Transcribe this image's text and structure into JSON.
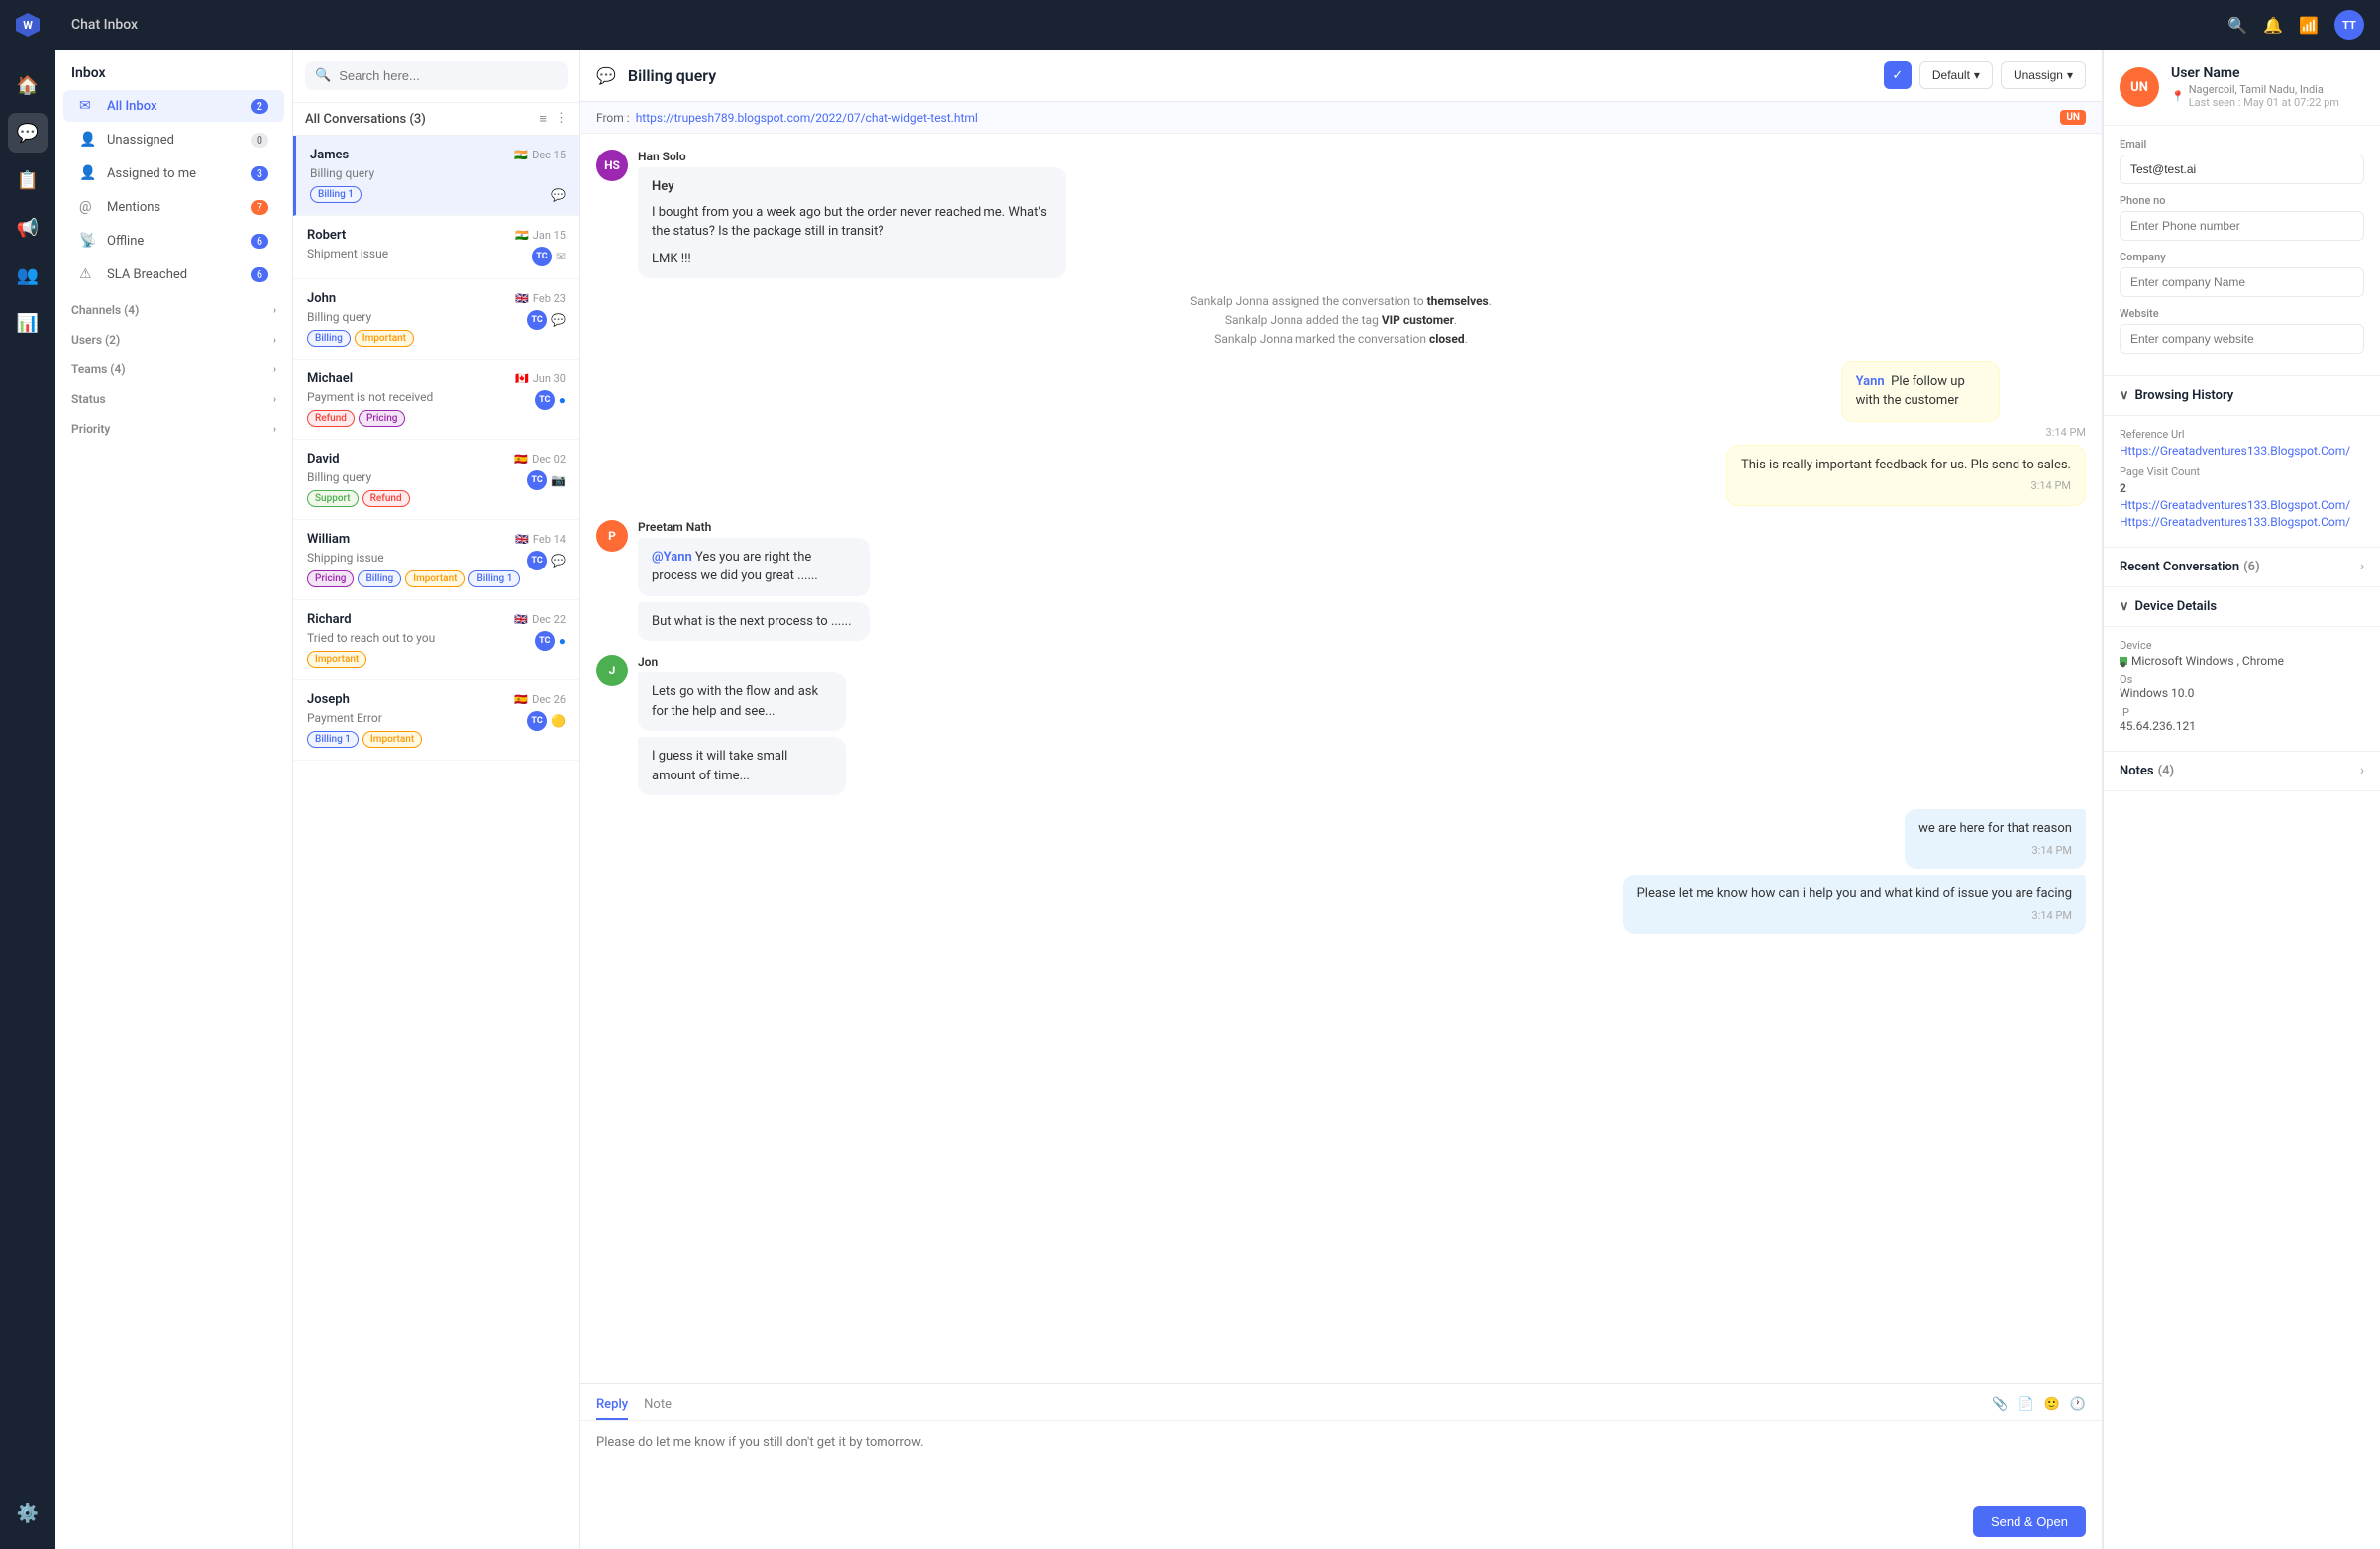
{
  "app": {
    "title": "Chat Inbox",
    "user_initials": "TT"
  },
  "nav": {
    "icons": [
      "🏠",
      "💬",
      "📋",
      "📢",
      "👥",
      "📊"
    ],
    "active_index": 1
  },
  "inbox_sidebar": {
    "header": "Inbox",
    "items": [
      {
        "id": "all-inbox",
        "label": "All Inbox",
        "icon": "✉",
        "badge": "2",
        "badge_type": "blue",
        "active": true
      },
      {
        "id": "unassigned",
        "label": "Unassigned",
        "icon": "👤",
        "badge": "0",
        "badge_type": "gray",
        "active": false
      },
      {
        "id": "assigned-to-me",
        "label": "Assigned to me",
        "icon": "👤",
        "badge": "3",
        "badge_type": "blue",
        "active": false
      },
      {
        "id": "mentions",
        "label": "Mentions",
        "icon": "@",
        "badge": "7",
        "badge_type": "orange",
        "active": false
      },
      {
        "id": "offline",
        "label": "Offline",
        "icon": "📡",
        "badge": "6",
        "badge_type": "blue",
        "active": false
      },
      {
        "id": "sla-breached",
        "label": "SLA Breached",
        "icon": "⚠",
        "badge": "6",
        "badge_type": "blue",
        "active": false
      }
    ],
    "sections": [
      {
        "label": "Channels (4)",
        "expandable": true
      },
      {
        "label": "Users (2)",
        "expandable": true
      },
      {
        "label": "Teams (4)",
        "expandable": true
      },
      {
        "label": "Status",
        "expandable": true
      },
      {
        "label": "Priority",
        "expandable": true
      }
    ]
  },
  "conv_panel": {
    "search_placeholder": "Search here...",
    "list_header": "All Conversations (3)",
    "conversations": [
      {
        "name": "James",
        "flag": "🇮🇳",
        "date": "Dec 15",
        "preview": "Billing query",
        "tags": [
          {
            "label": "Billing 1",
            "type": "billing"
          }
        ],
        "icon": "💬",
        "active": true,
        "avatar_color": "#4a6cf7",
        "avatar_initials": "TC"
      },
      {
        "name": "Robert",
        "flag": "🇮🇳",
        "date": "Jan 15",
        "preview": "Shipment issue",
        "tags": [],
        "icon": "✉",
        "active": false,
        "avatar_color": "#4a6cf7",
        "avatar_initials": "TC"
      },
      {
        "name": "John",
        "flag": "🇬🇧",
        "date": "Feb 23",
        "preview": "Billing query",
        "tags": [
          {
            "label": "Billing",
            "type": "billing"
          },
          {
            "label": "Important",
            "type": "important"
          }
        ],
        "icon": "💚",
        "active": false,
        "avatar_color": "#4a6cf7",
        "avatar_initials": "TC"
      },
      {
        "name": "Michael",
        "flag": "🇨🇦",
        "date": "Jun 30",
        "preview": "Payment is not received",
        "tags": [
          {
            "label": "Refund",
            "type": "refund"
          },
          {
            "label": "Pricing",
            "type": "pricing"
          }
        ],
        "icon": "🔵",
        "active": false,
        "avatar_color": "#4a6cf7",
        "avatar_initials": "TC"
      },
      {
        "name": "David",
        "flag": "🇪🇸",
        "date": "Dec 02",
        "preview": "Billing query",
        "tags": [
          {
            "label": "Support",
            "type": "support"
          },
          {
            "label": "Refund",
            "type": "refund"
          }
        ],
        "icon": "📷",
        "active": false,
        "avatar_color": "#4a6cf7",
        "avatar_initials": "TC"
      },
      {
        "name": "William",
        "flag": "🇬🇧",
        "date": "Feb 14",
        "preview": "Shipping issue",
        "tags": [
          {
            "label": "Pricing",
            "type": "pricing"
          },
          {
            "label": "Billing",
            "type": "billing"
          },
          {
            "label": "Important",
            "type": "important"
          },
          {
            "label": "Billing 1",
            "type": "billing"
          }
        ],
        "icon": "💬",
        "active": false,
        "avatar_color": "#4a6cf7",
        "avatar_initials": "TC"
      },
      {
        "name": "Richard",
        "flag": "🇬🇧",
        "date": "Dec 22",
        "preview": "Tried to reach out to you",
        "tags": [
          {
            "label": "Important",
            "type": "important"
          }
        ],
        "icon": "🔵",
        "active": false,
        "avatar_color": "#4a6cf7",
        "avatar_initials": "TC"
      },
      {
        "name": "Joseph",
        "flag": "🇪🇸",
        "date": "Dec 26",
        "preview": "Payment Error",
        "tags": [
          {
            "label": "Billing 1",
            "type": "billing"
          },
          {
            "label": "Important",
            "type": "important"
          }
        ],
        "icon": "🟡",
        "active": false,
        "avatar_color": "#4a6cf7",
        "avatar_initials": "TC"
      }
    ]
  },
  "chat": {
    "title": "Billing query",
    "title_icon": "💬",
    "from_label": "From :",
    "from_url": "https://trupesh789.blogspot.com/2022/07/chat-widget-test.html",
    "from_badge": "UN",
    "default_btn": "Default",
    "unassign_btn": "Unassign",
    "messages": [
      {
        "type": "incoming",
        "sender": "Han Solo",
        "initials": "HS",
        "avatar_color": "#9c27b0",
        "greeting": "Hey",
        "body": "I bought from you a week ago but the order never reached me. What's the status? Is the package still in transit?\n\nLMK !!!"
      },
      {
        "type": "system",
        "lines": [
          "Sankalp Jonna assigned the conversation to <strong>themselves</strong>.",
          "Sankalp Jonna added the tag <strong>VIP customer</strong>.",
          "Sankalp Jonna marked the conversation <strong>closed</strong>."
        ]
      },
      {
        "type": "outgoing-note",
        "sender": "Yann",
        "time": "3:14 PM",
        "body1": "Ple follow up with the customer",
        "body2": "This is really important feedback for us. Pls send to sales."
      },
      {
        "type": "incoming",
        "sender": "Preetam Nath",
        "initials": "P",
        "avatar_color": "#ff6b35",
        "mention": "@Yann",
        "body1": "Yes you are right the process we did you great ......",
        "body2": "But what is the next process to ......"
      },
      {
        "type": "incoming",
        "sender": "Jon",
        "initials": "J",
        "avatar_color": "#4caf50",
        "body1": "Lets go with the flow and ask for the help and see...",
        "body2": "I guess it will take small amount of time..."
      },
      {
        "type": "outgoing",
        "time": "3:14 PM",
        "body1": "we are here for that reason",
        "body2": "Please let me know how can i help you and what kind of issue you are facing"
      }
    ],
    "reply_tab": "Reply",
    "note_tab": "Note",
    "reply_placeholder": "Please do let me know if you still don't get it by tomorrow.",
    "send_btn": "Send & Open"
  },
  "right_panel": {
    "user_initials": "UN",
    "user_name": "User Name",
    "location": "Nagercoil, Tamil Nadu, India",
    "last_seen": "Last seen : May 01 at 07:22 pm",
    "email_label": "Email",
    "email_value": "Test@test.ai",
    "phone_label": "Phone no",
    "phone_placeholder": "Enter Phone number",
    "company_label": "Company",
    "company_placeholder": "Enter company Name",
    "website_label": "Website",
    "website_placeholder": "Enter company website",
    "browsing_title": "Browsing History",
    "ref_url_label": "Reference Url",
    "ref_url": "Https://Greatadventures133.Blogspot.Com/",
    "page_visit_label": "Page Visit Count",
    "page_visit_count": "2",
    "page_urls": [
      "Https://Greatadventures133.Blogspot.Com/",
      "Https://Greatadventures133.Blogspot.Com/"
    ],
    "recent_conv_label": "Recent Conversation",
    "recent_conv_count": "(6)",
    "device_title": "Device Details",
    "device_label": "Device",
    "device_value": "Microsoft Windows , Chrome",
    "os_label": "Os",
    "os_value": "Windows 10.0",
    "ip_label": "IP",
    "ip_value": "45.64.236.121",
    "notes_label": "Notes",
    "notes_count": "(4)"
  }
}
